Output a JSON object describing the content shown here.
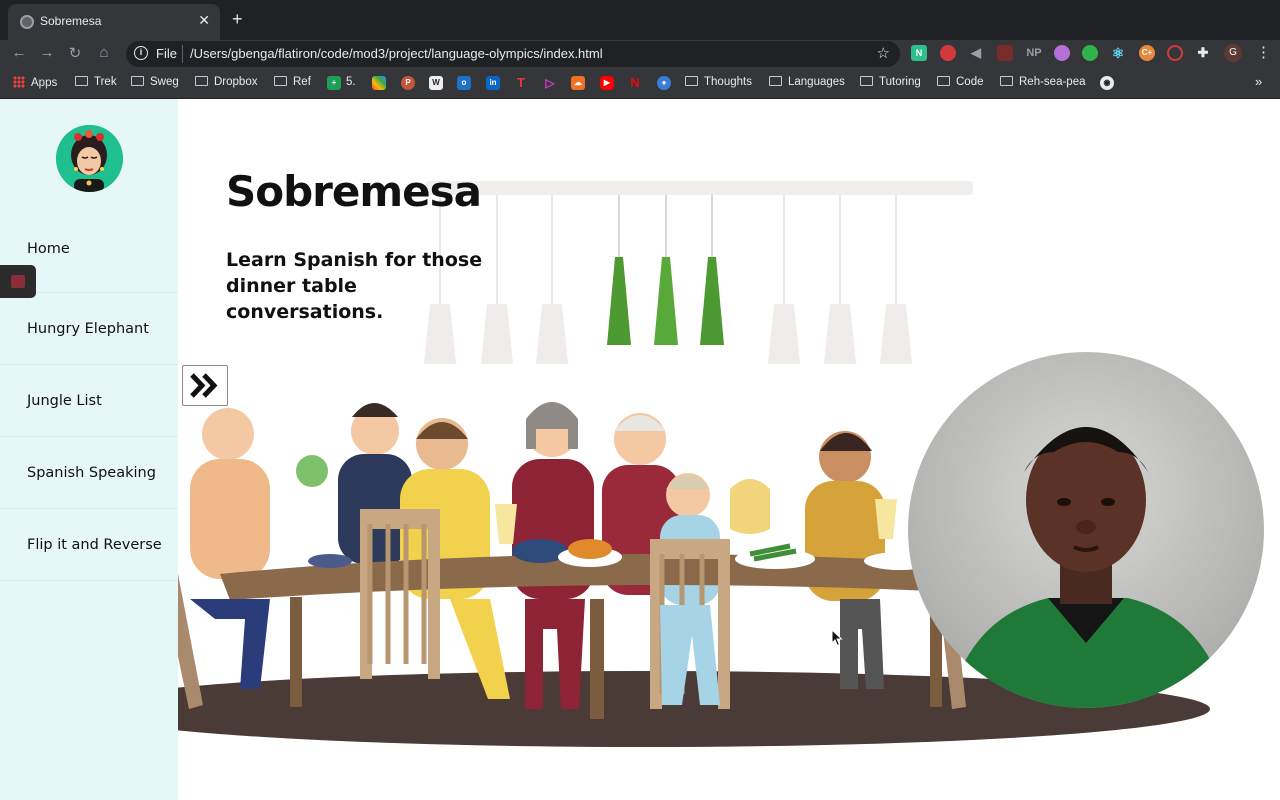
{
  "browser": {
    "tab_title": "Sobremesa",
    "address_scheme": "File",
    "address_url": "/Users/gbenga/flatiron/code/mod3/project/language-olympics/index.html",
    "profile_initial": "G",
    "extensions": [
      "N",
      "NP",
      "C+"
    ],
    "bookmarks": {
      "apps": "Apps",
      "trek": "Trek",
      "sweg": "Sweg",
      "dropbox": "Dropbox",
      "ref": "Ref",
      "five": "5.",
      "thoughts": "Thoughts",
      "languages": "Languages",
      "tutoring": "Tutoring",
      "code": "Code",
      "reh_sea_pea": "Reh-sea-pea"
    }
  },
  "sidebar": {
    "items": [
      {
        "label": "Home"
      },
      {
        "label": "Hungry Elephant"
      },
      {
        "label": "Jungle List"
      },
      {
        "label": "Spanish Speaking"
      },
      {
        "label": "Flip it and Reverse"
      }
    ]
  },
  "main": {
    "title": "Sobremesa",
    "subtitle": "Learn Spanish for those dinner table conversations."
  },
  "colors": {
    "sidebar_bg": "#e6f7f7",
    "lamp_green": "#4e9a32",
    "table_wood": "#8a6a4a",
    "floor_shadow": "#4a3b37"
  },
  "icons": {
    "expand": "double-chevron-right-icon",
    "stop": "stop-recording-icon"
  }
}
